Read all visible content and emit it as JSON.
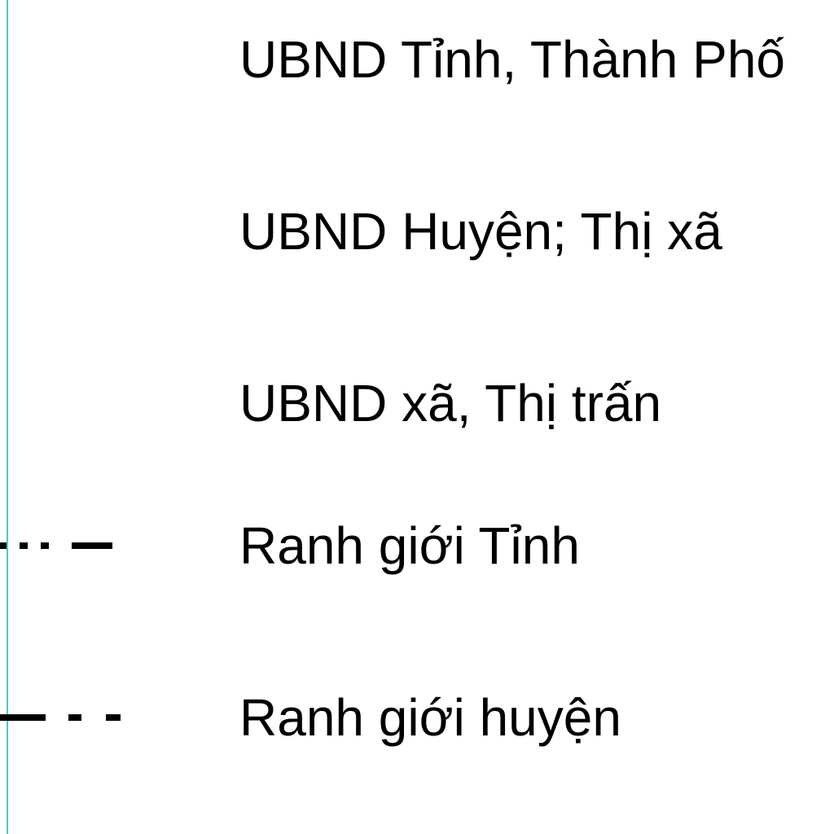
{
  "legend": {
    "items": [
      {
        "label": "UBND Tỉnh, Thành Phố",
        "symbol": "none"
      },
      {
        "label": "UBND Huyện; Thị xã",
        "symbol": "none"
      },
      {
        "label": "UBND xã, Thị trấn",
        "symbol": "none"
      },
      {
        "label": "Ranh giới Tỉnh",
        "symbol": "province-boundary-line"
      },
      {
        "label": "Ranh giới huyện",
        "symbol": "district-boundary-line"
      }
    ],
    "colors": {
      "text": "#000000",
      "frame_line": "#26d9e6",
      "boundary_line": "#000000"
    }
  }
}
